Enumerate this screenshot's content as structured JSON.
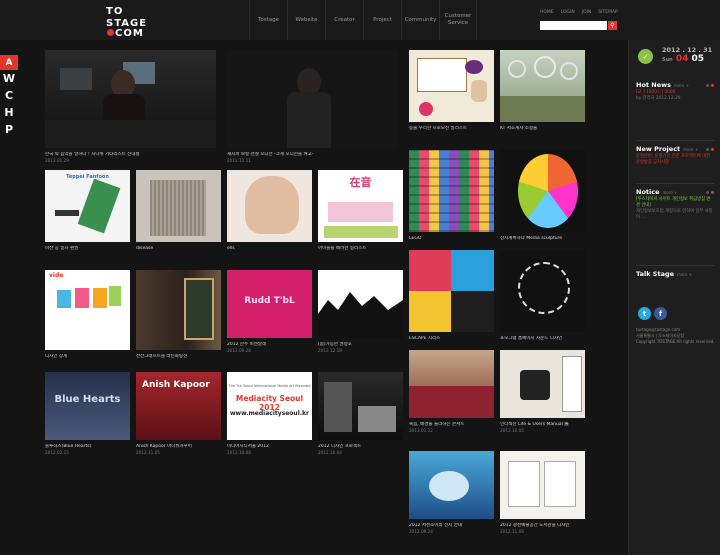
{
  "header": {
    "logo_top": "TO",
    "logo_stage": "STAGE",
    "logo_com": "COM",
    "nav": [
      "Tostage",
      "Website",
      "Creator",
      "Project",
      "Community",
      "Customer Service"
    ],
    "util": [
      "HOME",
      "LOGIN",
      "JOIN",
      "SITEMAP"
    ],
    "search_placeholder": "",
    "search_icon": "search-icon"
  },
  "side_menu": {
    "first": "A",
    "letters": [
      "W",
      "C",
      "H",
      "P"
    ]
  },
  "tiles": [
    {
      "caption": "한국 락 음악을 말하다 ! 시나위 기타리스트 신대철",
      "date": "2013.01.29"
    },
    {
      "caption": "재시퍼 보컬 천철 오디션 -크게 오디션을 켜고-",
      "date": "2012.12.11"
    },
    {
      "caption": "동물 우리한 프로모션 일러스트",
      "date": ""
    },
    {
      "caption": "KT 서초계사 조형물",
      "date": ""
    },
    {
      "caption": "마산 공 일차 편권",
      "date": ""
    },
    {
      "caption": "disease",
      "date": ""
    },
    {
      "caption": "ells",
      "date": ""
    },
    {
      "caption": "아이들을 배려한 일러스트",
      "date": ""
    },
    {
      "caption": "LEGO",
      "date": ""
    },
    {
      "caption": "전시계획하다 Media sculpture",
      "date": ""
    },
    {
      "caption": "디자인 장게",
      "date": ""
    },
    {
      "caption": "선전그래프트들 라틴화랑전",
      "date": ""
    },
    {
      "caption": "2012 한주 비엔날레",
      "date": "2012.09.28"
    },
    {
      "caption": "(봄)가능한 권정호",
      "date": "2012.12.18"
    },
    {
      "caption": "ESCAPE 시리즈",
      "date": ""
    },
    {
      "caption": "포모그램 홈페이지 사운드 디자인",
      "date": ""
    },
    {
      "caption": "블루하츠(Blue Hearts)",
      "date": "2012.02.15"
    },
    {
      "caption": "Anish Kapoor 아니쉬카푸어",
      "date": "2012.11.05"
    },
    {
      "caption": "미디어시티서울 2012",
      "date": "2012.10.08"
    },
    {
      "caption": "2012 디자인 프로젝트",
      "date": "2012.10.04"
    },
    {
      "caption": "복음, 배경을 울리하는 콘서트",
      "date": "2013.01.12"
    },
    {
      "caption": "인터섹션 Life & Users Manual 展",
      "date": "2012.10.05"
    },
    {
      "caption": "2012 서천조이의 전시 안내",
      "date": "2012.09.24"
    },
    {
      "caption": "2012 광천예술공간 도서관을 디자인",
      "date": "2012.11.08"
    }
  ],
  "thumb_text": {
    "tile_5_title": "Teppei Fanfoon",
    "tile_8_title": "在音",
    "tile_11_title": "vide",
    "tile_13_title": "Rudd T'bL",
    "tile_17_title": "Blue Hearts",
    "tile_18_title": "Anish Kapoor",
    "tile_19_line1": "The 7th Seoul International Media Art Biennale",
    "tile_19_title": "Mediacity Seoul 2012",
    "tile_19_url": "www.mediacityseoul.kr"
  },
  "sidebar": {
    "date_ymd": "2012 . 12 . 31",
    "date_day": "Sun",
    "date_md_a": "04",
    "date_md_b": "05",
    "hot_news_title": "Hot News",
    "hot_news_more": "more +",
    "hot_news_body": "[교 ] 1000 [ ] 0000",
    "hot_news_item": "by 관리자 2012.12.29",
    "new_project_title": "New Project",
    "new_project_more": "more +",
    "new_project_body": "운영관련, 운영기관 전문 프로젝트에 대한 운영방침 공지사항",
    "notice_title": "Notice",
    "notice_more": "more +",
    "notice_body": "[투스테이지 사이트 개인정보 취급방침 변경 안내]",
    "notice_body2": "개인정보보호법 개정으로 인하여 일부 사항이 ...",
    "talk_title": "Talk Stage",
    "talk_more": "more +",
    "contact_email": "tostage@tostage.com",
    "contact_line": "서울특별시 | 투스테이지닷컴",
    "copyright": "Copyright TOSTAGE All rights reserved."
  },
  "colors": {
    "accent": "#e5352a",
    "green": "#8bc34a",
    "bg": "#141414"
  }
}
